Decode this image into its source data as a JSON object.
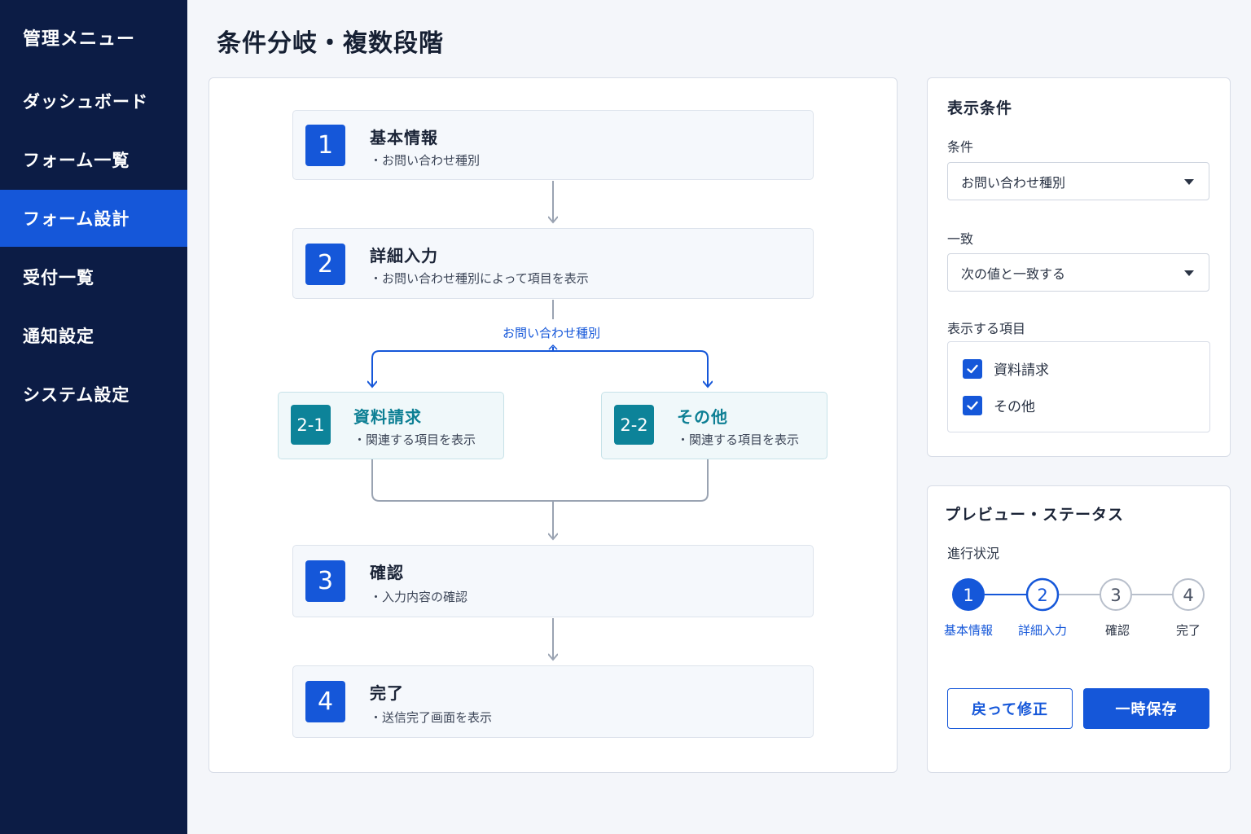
{
  "sidebar": {
    "title": "管理メニュー",
    "items": [
      {
        "label": "ダッシュボード"
      },
      {
        "label": "フォーム一覧"
      },
      {
        "label": "フォーム設計"
      },
      {
        "label": "受付一覧"
      },
      {
        "label": "通知設定"
      },
      {
        "label": "システム設定"
      }
    ],
    "active_item": "フォーム設計"
  },
  "page": {
    "title": "条件分岐・複数段階"
  },
  "flow": {
    "steps": [
      {
        "num": "1",
        "title": "基本情報",
        "sub": "・お問い合わせ種別"
      },
      {
        "num": "2",
        "title": "詳細入力",
        "sub": "・お問い合わせ種別によって項目を表示"
      },
      {
        "num": "3",
        "title": "確認",
        "sub": "・入力内容の確認"
      },
      {
        "num": "4",
        "title": "完了",
        "sub": "・送信完了画面を表示"
      }
    ],
    "branch_label": "お問い合わせ種別",
    "branches": [
      {
        "num": "2-1",
        "title": "資料請求",
        "sub": "・関連する項目を表示"
      },
      {
        "num": "2-2",
        "title": "その他",
        "sub": "・関連する項目を表示"
      }
    ]
  },
  "conditions": {
    "title": "表示条件",
    "condition_label": "条件",
    "condition_value": "お問い合わせ種別",
    "match_label": "一致",
    "match_value": "次の値と一致する",
    "items_label": "表示する項目",
    "items": [
      {
        "label": "資料請求",
        "checked": true
      },
      {
        "label": "その他",
        "checked": true
      }
    ]
  },
  "status": {
    "title": "プレビュー・ステータス",
    "progress_label": "進行状況",
    "steps": [
      {
        "num": "1",
        "label": "基本情報",
        "state": "done"
      },
      {
        "num": "2",
        "label": "詳細入力",
        "state": "current"
      },
      {
        "num": "3",
        "label": "確認",
        "state": "pending"
      },
      {
        "num": "4",
        "label": "完了",
        "state": "pending"
      }
    ],
    "back_button": "戻って修正",
    "save_button": "一時保存"
  },
  "colors": {
    "sidebar_bg": "#0c1c45",
    "accent": "#1557d9",
    "branch_accent": "#0d8399",
    "connector": "#9aa3b2"
  }
}
